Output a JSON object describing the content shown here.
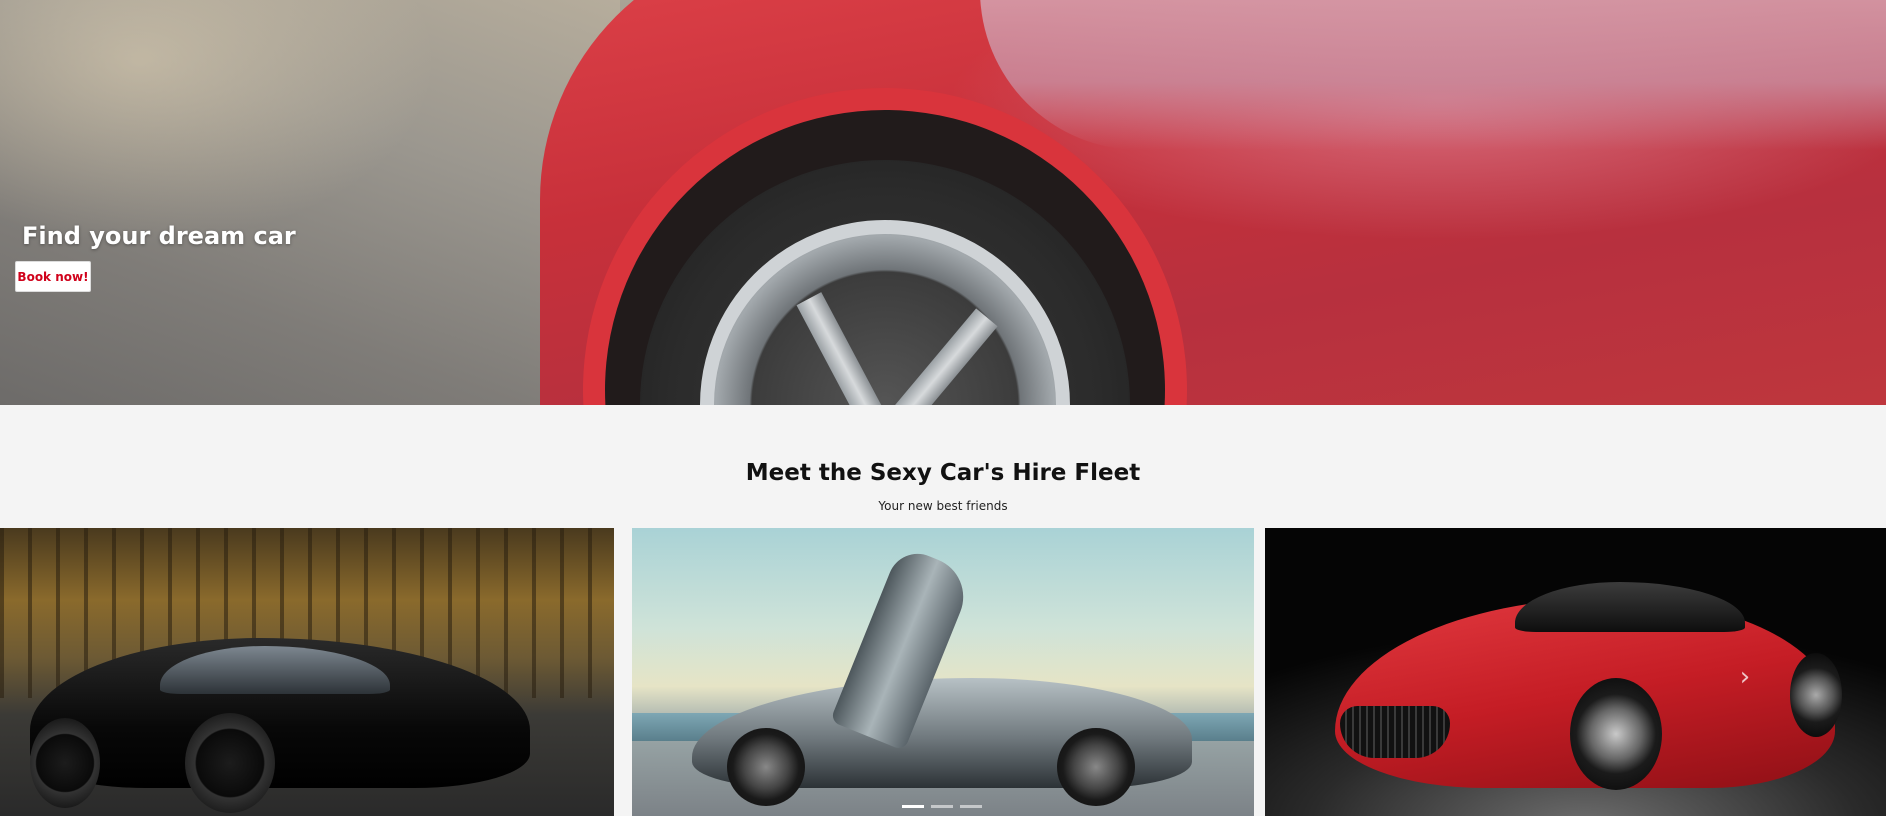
{
  "hero": {
    "title": "Find your dream car",
    "cta_label": "Book now!",
    "cta_color": "#d0021b"
  },
  "fleet": {
    "title": "Meet the Sexy Car's Hire Fleet",
    "subtitle": "Your new best friends",
    "cars": [
      {
        "image": "black-supercar-in-forest"
      },
      {
        "image": "silver-concept-car-by-sea"
      },
      {
        "image": "red-coupe-studio"
      }
    ]
  },
  "carousel": {
    "next_icon": "chevron-right-icon",
    "slides": 3,
    "active_slide": 1
  }
}
